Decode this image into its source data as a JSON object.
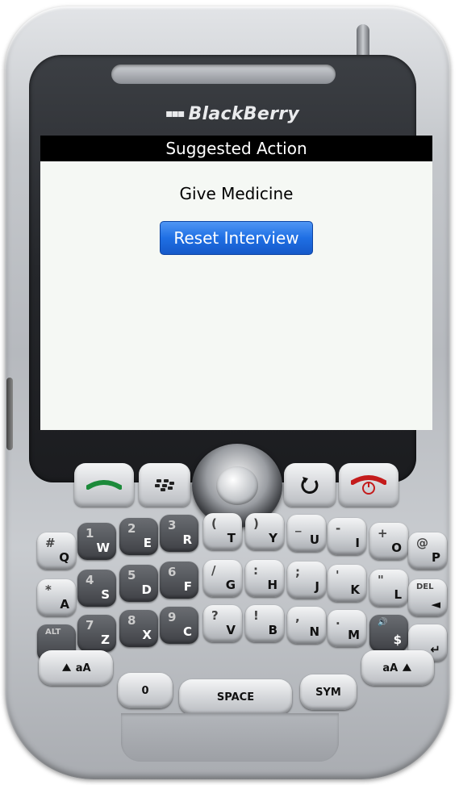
{
  "device": {
    "brand_label": "BlackBerry"
  },
  "screen": {
    "title": "Suggested Action",
    "message": "Give Medicine",
    "reset_button_label": "Reset Interview"
  },
  "keyboard": {
    "row1": [
      {
        "main": "Q",
        "alt": "#"
      },
      {
        "main": "W",
        "alt": "1"
      },
      {
        "main": "E",
        "alt": "2"
      },
      {
        "main": "R",
        "alt": "3"
      },
      {
        "main": "T",
        "alt": "("
      },
      {
        "main": "Y",
        "alt": ")"
      },
      {
        "main": "U",
        "alt": "_"
      },
      {
        "main": "I",
        "alt": "-"
      },
      {
        "main": "O",
        "alt": "+"
      },
      {
        "main": "P",
        "alt": "@"
      }
    ],
    "row2": [
      {
        "main": "A",
        "alt": "*"
      },
      {
        "main": "S",
        "alt": "4"
      },
      {
        "main": "D",
        "alt": "5"
      },
      {
        "main": "F",
        "alt": "6"
      },
      {
        "main": "G",
        "alt": "/"
      },
      {
        "main": "H",
        "alt": ":"
      },
      {
        "main": "J",
        "alt": ";"
      },
      {
        "main": "K",
        "alt": "'"
      },
      {
        "main": "L",
        "alt": "\""
      },
      {
        "main": "◄",
        "alt": "DEL"
      }
    ],
    "row3": [
      {
        "main": "",
        "alt": "ALT"
      },
      {
        "main": "Z",
        "alt": "7"
      },
      {
        "main": "X",
        "alt": "8"
      },
      {
        "main": "C",
        "alt": "9"
      },
      {
        "main": "V",
        "alt": "?"
      },
      {
        "main": "B",
        "alt": "!"
      },
      {
        "main": "N",
        "alt": ","
      },
      {
        "main": "M",
        "alt": "."
      },
      {
        "main": "$",
        "alt": "🔊"
      },
      {
        "main": "↵",
        "alt": ""
      }
    ],
    "zero_key": "0",
    "space_label": "SPACE",
    "sym_label": "SYM",
    "shift_left_label": "aA",
    "shift_right_label": "aA"
  },
  "colors": {
    "call_green": "#1c8a3a",
    "end_red": "#c41b1b",
    "button_blue": "#1f6fe4"
  }
}
